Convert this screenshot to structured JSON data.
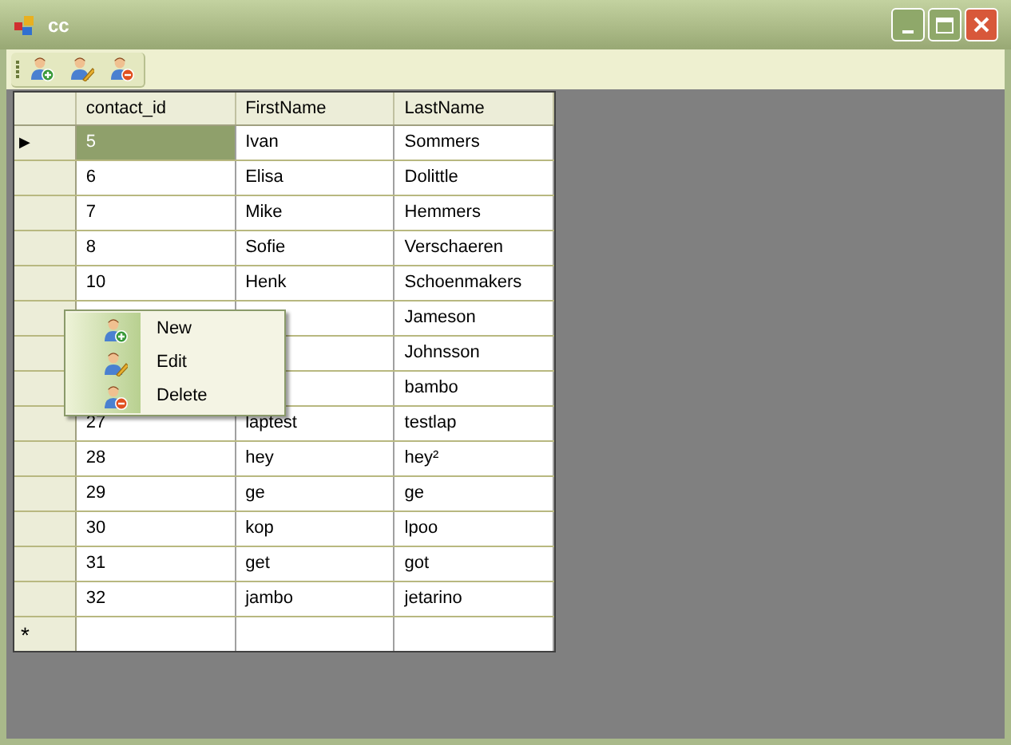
{
  "window": {
    "title": "cc"
  },
  "toolbar": {
    "buttons": [
      {
        "kind": "add"
      },
      {
        "kind": "edit"
      },
      {
        "kind": "delete"
      }
    ]
  },
  "grid": {
    "columns": [
      "contact_id",
      "FirstName",
      "LastName"
    ],
    "rows": [
      {
        "current": true,
        "cells": [
          {
            "text": "5",
            "selected": true
          },
          {
            "text": "Ivan",
            "selected": false
          },
          {
            "text": "Sommers",
            "selected": false
          }
        ]
      },
      {
        "current": false,
        "cells": [
          {
            "text": "6",
            "selected": false
          },
          {
            "text": "Elisa",
            "selected": false
          },
          {
            "text": "Dolittle",
            "selected": false
          }
        ]
      },
      {
        "current": false,
        "cells": [
          {
            "text": "7",
            "selected": false
          },
          {
            "text": "Mike",
            "selected": false
          },
          {
            "text": "Hemmers",
            "selected": false
          }
        ]
      },
      {
        "current": false,
        "cells": [
          {
            "text": "8",
            "selected": false
          },
          {
            "text": "Sofie",
            "selected": false
          },
          {
            "text": "Verschaeren",
            "selected": false
          }
        ]
      },
      {
        "current": false,
        "cells": [
          {
            "text": "10",
            "selected": false
          },
          {
            "text": "Henk",
            "selected": false
          },
          {
            "text": "Schoenmakers",
            "selected": false
          }
        ]
      },
      {
        "current": false,
        "cells": [
          null,
          null,
          {
            "text": "Jameson",
            "selected": false
          }
        ]
      },
      {
        "current": false,
        "cells": [
          null,
          null,
          {
            "text": "Johnsson",
            "selected": false
          }
        ]
      },
      {
        "current": false,
        "cells": [
          null,
          null,
          {
            "text": "bambo",
            "selected": false
          }
        ]
      },
      {
        "current": false,
        "cells": [
          {
            "text": "27",
            "selected": false
          },
          {
            "text": "laptest",
            "selected": false
          },
          {
            "text": "testlap",
            "selected": false
          }
        ]
      },
      {
        "current": false,
        "cells": [
          {
            "text": "28",
            "selected": false
          },
          {
            "text": "hey",
            "selected": false
          },
          {
            "text": "hey²",
            "selected": false
          }
        ]
      },
      {
        "current": false,
        "cells": [
          {
            "text": "29",
            "selected": false
          },
          {
            "text": "ge",
            "selected": false
          },
          {
            "text": "ge",
            "selected": false
          }
        ]
      },
      {
        "current": false,
        "cells": [
          {
            "text": "30",
            "selected": false
          },
          {
            "text": "kop",
            "selected": false
          },
          {
            "text": "lpoo",
            "selected": false
          }
        ]
      },
      {
        "current": false,
        "cells": [
          {
            "text": "31",
            "selected": false
          },
          {
            "text": "get",
            "selected": false
          },
          {
            "text": "got",
            "selected": false
          }
        ]
      },
      {
        "current": false,
        "cells": [
          {
            "text": "32",
            "selected": false
          },
          {
            "text": "jambo",
            "selected": false
          },
          {
            "text": "jetarino",
            "selected": false
          }
        ]
      }
    ],
    "current_row_marker": "▶",
    "new_row_marker": "*"
  },
  "context_menu": {
    "items": [
      {
        "label": "New",
        "kind": "add"
      },
      {
        "label": "Edit",
        "kind": "edit"
      },
      {
        "label": "Delete",
        "kind": "delete"
      }
    ]
  }
}
